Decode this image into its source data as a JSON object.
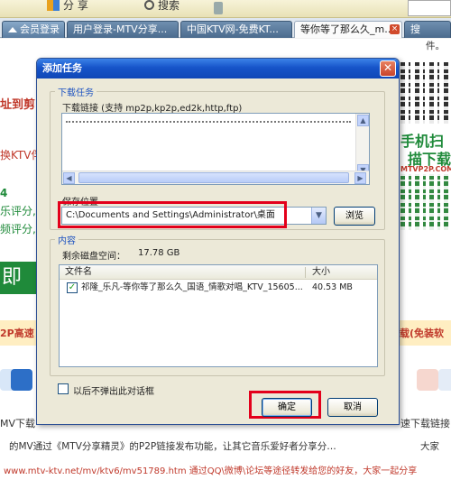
{
  "browser": {
    "toolbar": {
      "share_label": "分 享",
      "search_label": "搜索"
    },
    "tabs": [
      {
        "label": "会员登录"
      },
      {
        "label": "用户登录-MTV分享..."
      },
      {
        "label": "中国KTV网-免费KT..."
      },
      {
        "label": "等你等了那么久_m..."
      },
      {
        "label": "搜"
      }
    ],
    "page": {
      "left_text_1": "址到剪",
      "left_text_2": "换KTV伴",
      "left_text_3": "4",
      "left_text_4": "乐评分,",
      "left_text_5": "频评分,",
      "left_text_6": "即播",
      "left_text_7": "2P高速",
      "left_text_8": "MV下载",
      "right_text_1": "手机扫",
      "right_text_2": "描下载",
      "right_text_3": "MTVP2P.COM",
      "right_text_4": "载(免装软",
      "right_text_5": "速下载链接",
      "right_text_6": "大家",
      "right_text_7": "件。",
      "bottom_line_1": "的MV通过《MTV分享精灵》的P2P链接发布功能，让其它音乐爱好者分享分…",
      "bottom_line_2": "www.mtv-ktv.net/mv/ktv6/mv51789.htm 通过QQ\\微博\\论坛等途径转发给您的好友，大家一起分享"
    }
  },
  "dialog": {
    "title": "添加任务",
    "download_group_label": "下载任务",
    "download_link_label": "下载链接 (支持 mp2p,kp2p,ed2k,http,ftp)",
    "save_location_label": "保存位置",
    "save_path": "C:\\Documents and Settings\\Administrator\\桌面",
    "browse_button": "浏览",
    "content_group_label": "内容",
    "free_space_label": "剩余磁盘空间：",
    "free_space_value": "17.78 GB",
    "list_headers": {
      "name": "文件名",
      "size": "大小"
    },
    "files": [
      {
        "name": "祁隆_乐凡-等你等了那么久_国语_情歌对唱_KTV_15605...",
        "size": "40.53 MB",
        "checked": true
      }
    ],
    "no_popup_label": "以后不弹出此对话框",
    "ok_button": "确定",
    "cancel_button": "取消"
  }
}
